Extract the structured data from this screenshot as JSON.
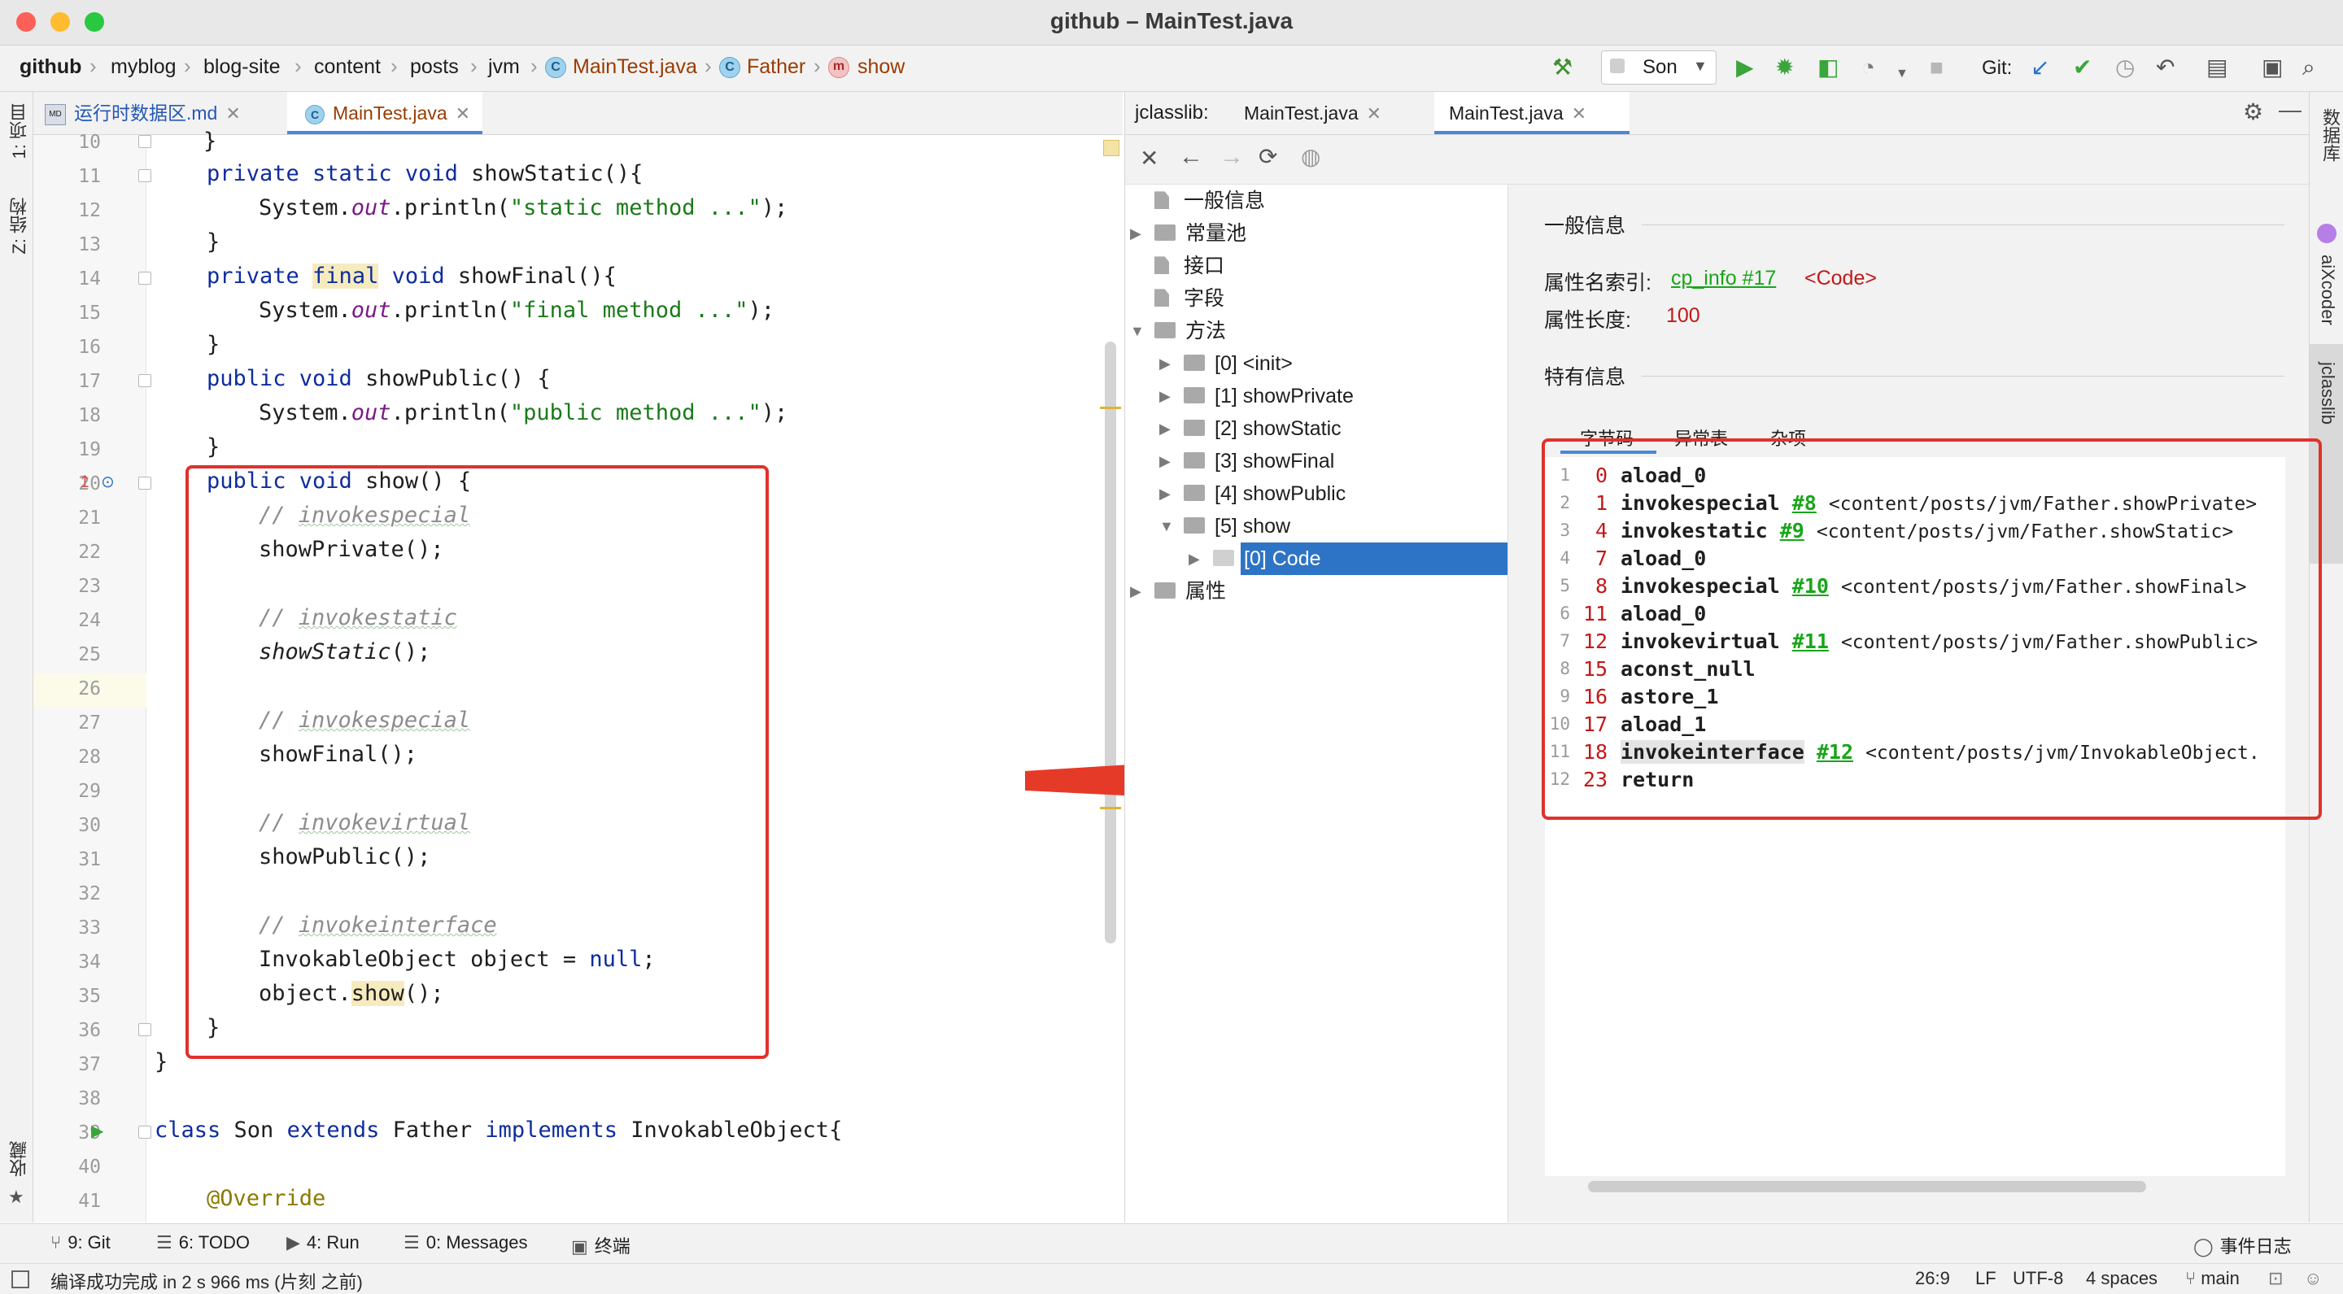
{
  "window": {
    "title": "github – MainTest.java"
  },
  "breadcrumbs": [
    "github",
    "myblog",
    "blog-site",
    "content",
    "posts",
    "jvm",
    "MainTest.java",
    "Father",
    "show"
  ],
  "toolbar": {
    "run_config": "Son",
    "git_label": "Git:"
  },
  "left_strip": {
    "project": "1: 项目",
    "structure": "Z: 结构",
    "favorites": "收藏"
  },
  "right_strip": {
    "database": "数据库",
    "aixcoder": "aiXcoder",
    "jclasslib": "jclasslib"
  },
  "editor_tabs": [
    {
      "label": "运行时数据区.md",
      "active": false
    },
    {
      "label": "MainTest.java",
      "active": true
    }
  ],
  "editor": {
    "line_numbers": [
      "10",
      "11",
      "12",
      "13",
      "14",
      "15",
      "16",
      "17",
      "18",
      "19",
      "20",
      "21",
      "22",
      "23",
      "24",
      "25",
      "26",
      "27",
      "28",
      "29",
      "30",
      "31",
      "32",
      "33",
      "34",
      "35",
      "36",
      "37",
      "38",
      "39",
      "40",
      "41"
    ],
    "lines": {
      "l10": "}",
      "l11_kw": "private static void ",
      "l11_rest": "showStatic(){",
      "l12_a": "System.",
      "l12_out": "out",
      "l12_b": ".println(",
      "l12_str": "\"static method ...\"",
      "l12_c": ");",
      "l13": "}",
      "l14_kw": "private ",
      "l14_final": "final",
      "l14_kw2": " void ",
      "l14_rest": "showFinal(){",
      "l15_a": "System.",
      "l15_out": "out",
      "l15_b": ".println(",
      "l15_str": "\"final method ...\"",
      "l15_c": ");",
      "l16": "}",
      "l17_kw": "public void ",
      "l17_rest": "showPublic() {",
      "l18_a": "System.",
      "l18_out": "out",
      "l18_b": ".println(",
      "l18_str": "\"public method ...\"",
      "l18_c": ");",
      "l19": "}",
      "l20_kw": "public void ",
      "l20_rest": "show() {",
      "l21_c": "// ",
      "l21_w": "invokespecial",
      "l22": "showPrivate();",
      "l24_c": "// ",
      "l24_w": "invokestatic",
      "l25": "showStatic",
      "l25_b": "();",
      "l27_c": "// ",
      "l27_w": "invokespecial",
      "l28": "showFinal();",
      "l30_c": "// ",
      "l30_w": "invokevirtual",
      "l31": "showPublic();",
      "l33_c": "// ",
      "l33_w": "invokeinterface",
      "l34_a": "InvokableObject object = ",
      "l34_null": "null",
      "l34_b": ";",
      "l35_a": "object.",
      "l35_show": "show",
      "l35_b": "();",
      "l36": "}",
      "l37": "}",
      "l39_class": "class ",
      "l39_son": "Son ",
      "l39_ext": "extends ",
      "l39_father": "Father ",
      "l39_impl": "implements ",
      "l39_rest": "InvokableObject{",
      "l41": "@Override"
    }
  },
  "jclasslib_tabs": {
    "prefix": "jclasslib:",
    "tab1": "MainTest.java",
    "tab2": "MainTest.java"
  },
  "tree": {
    "general": "一般信息",
    "constant_pool": "常量池",
    "interfaces": "接口",
    "fields": "字段",
    "methods": "方法",
    "m0": "[0] <init>",
    "m1": "[1] showPrivate",
    "m2": "[2] showStatic",
    "m3": "[3] showFinal",
    "m4": "[4] showPublic",
    "m5": "[5] show",
    "code": "[0] Code",
    "attributes": "属性"
  },
  "detail": {
    "general_header": "一般信息",
    "attr_name_label": "属性名索引:",
    "attr_name_link": "cp_info #17",
    "attr_name_val": "<Code>",
    "attr_len_label": "属性长度:",
    "attr_len_val": "100",
    "specific_header": "特有信息",
    "tabs": [
      "字节码",
      "异常表",
      "杂项"
    ]
  },
  "bytecode": [
    {
      "n": "1",
      "off": "0",
      "ins": "aload_0",
      "ref": "",
      "desc": ""
    },
    {
      "n": "2",
      "off": "1",
      "ins": "invokespecial",
      "ref": "#8",
      "desc": "<content/posts/jvm/Father.showPrivate>"
    },
    {
      "n": "3",
      "off": "4",
      "ins": "invokestatic",
      "ref": "#9",
      "desc": "<content/posts/jvm/Father.showStatic>"
    },
    {
      "n": "4",
      "off": "7",
      "ins": "aload_0",
      "ref": "",
      "desc": ""
    },
    {
      "n": "5",
      "off": "8",
      "ins": "invokespecial",
      "ref": "#10",
      "desc": "<content/posts/jvm/Father.showFinal>"
    },
    {
      "n": "6",
      "off": "11",
      "ins": "aload_0",
      "ref": "",
      "desc": ""
    },
    {
      "n": "7",
      "off": "12",
      "ins": "invokevirtual",
      "ref": "#11",
      "desc": "<content/posts/jvm/Father.showPublic>"
    },
    {
      "n": "8",
      "off": "15",
      "ins": "aconst_null",
      "ref": "",
      "desc": ""
    },
    {
      "n": "9",
      "off": "16",
      "ins": "astore_1",
      "ref": "",
      "desc": ""
    },
    {
      "n": "10",
      "off": "17",
      "ins": "aload_1",
      "ref": "",
      "desc": ""
    },
    {
      "n": "11",
      "off": "18",
      "ins": "invokeinterface",
      "ref": "#12",
      "desc": "<content/posts/jvm/InvokableObject."
    },
    {
      "n": "12",
      "off": "23",
      "ins": "return",
      "ref": "",
      "desc": ""
    }
  ],
  "tool_windows": [
    {
      "label": "9: Git"
    },
    {
      "label": "6: TODO"
    },
    {
      "label": "4: Run"
    },
    {
      "label": "0: Messages"
    },
    {
      "label": "终端"
    }
  ],
  "event_log": "事件日志",
  "status": {
    "message": "编译成功完成 in 2 s 966 ms (片刻 之前)",
    "position": "26:9",
    "line_sep": "LF",
    "encoding": "UTF-8",
    "indent": "4 spaces",
    "branch": "main"
  },
  "colors": {
    "accent_red": "#e0322b",
    "selection_blue": "#2e74c6",
    "link_green": "#19a519"
  }
}
